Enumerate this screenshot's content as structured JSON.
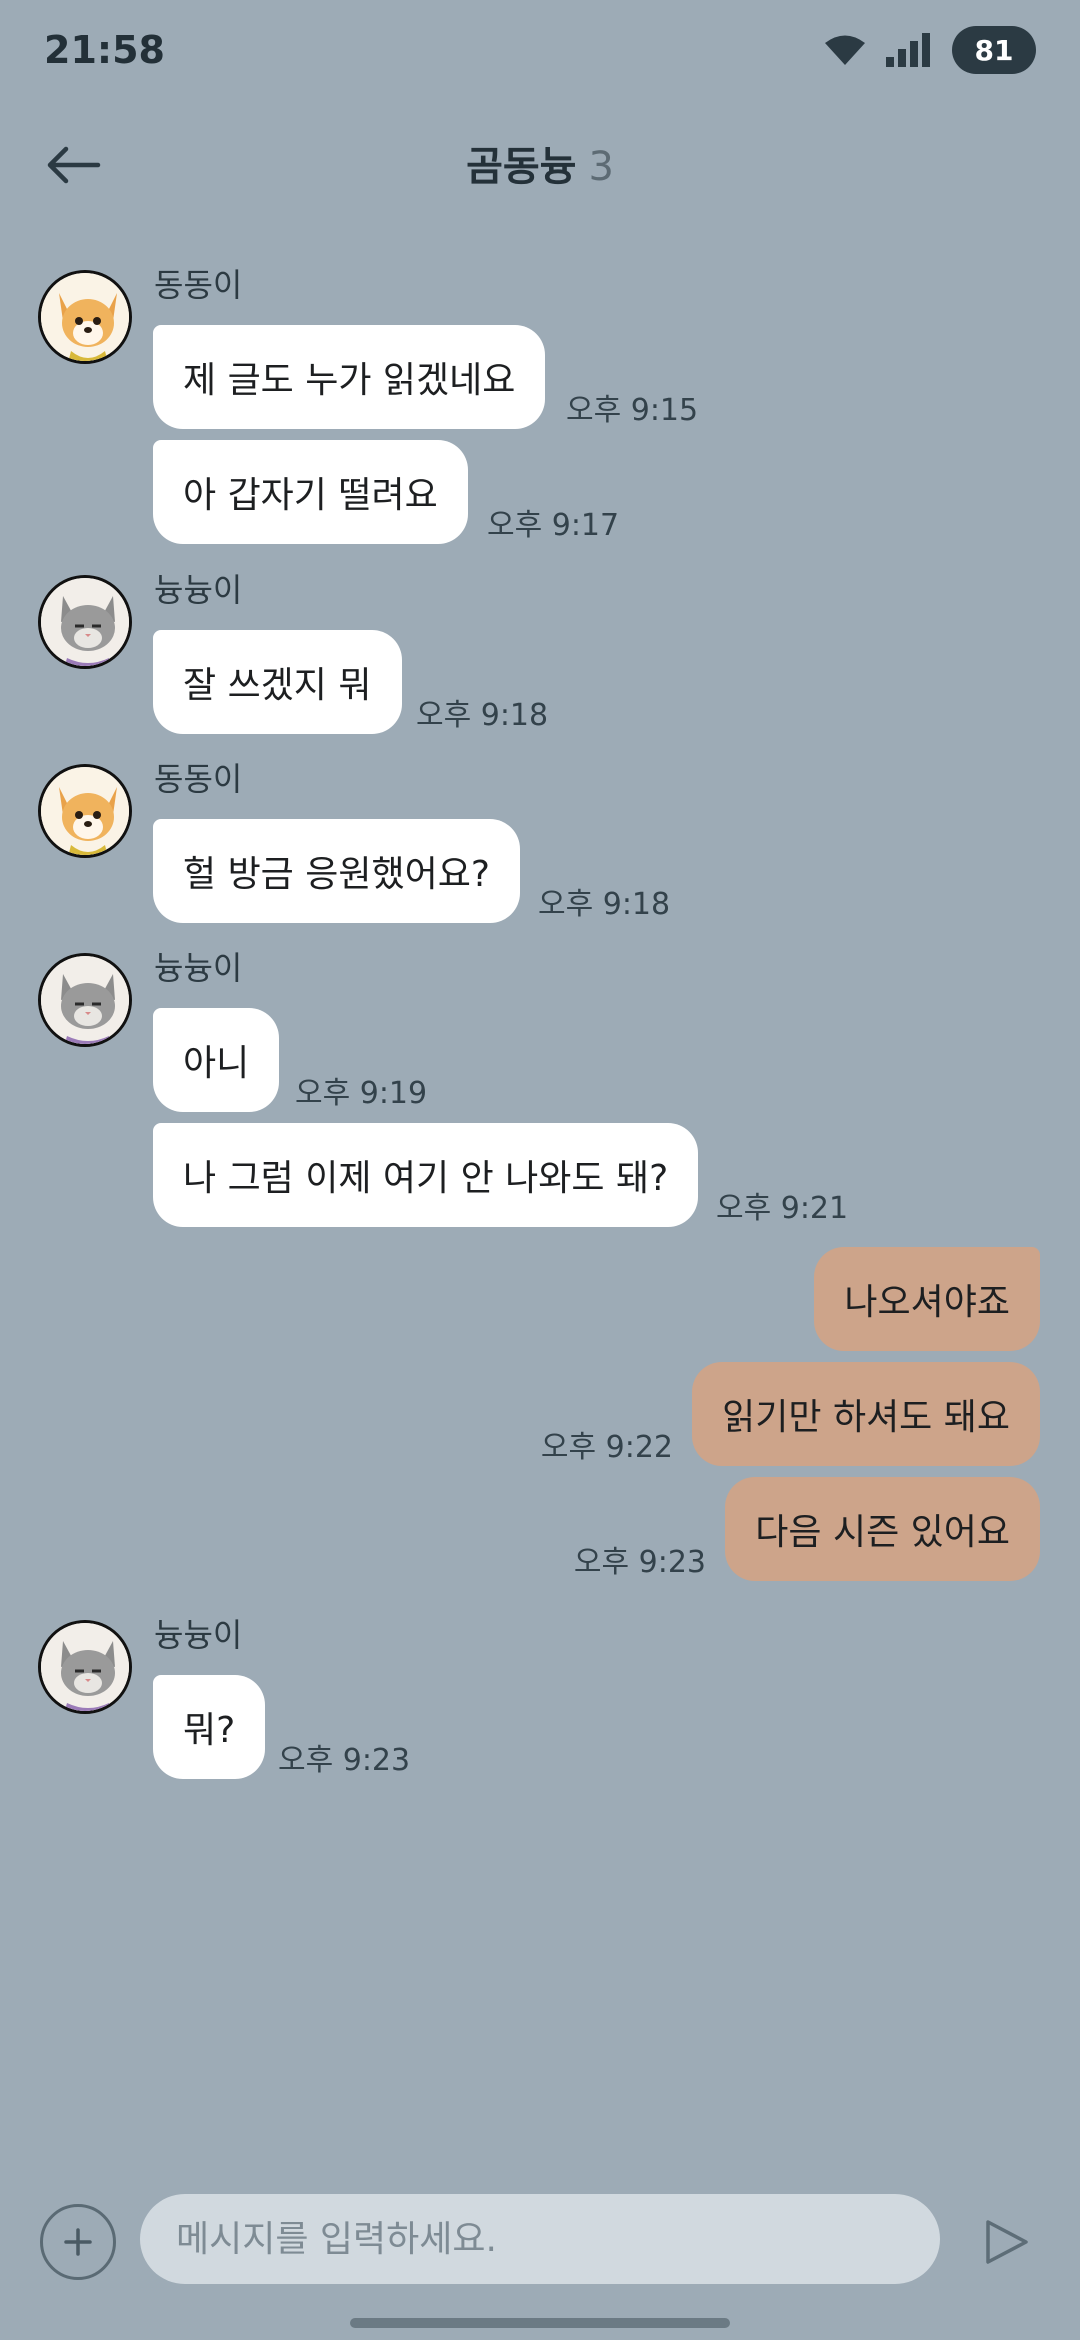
{
  "status_bar": {
    "time": "21:58",
    "battery": "81"
  },
  "header": {
    "title": "곰동늉",
    "count": "3"
  },
  "messages": [
    {
      "sender": "동동이",
      "avatar": "dog-avatar",
      "bubbles": [
        {
          "text": "제 글도 누가 읽겠네요",
          "time": "오후 9:15"
        },
        {
          "text": "아 갑자기 떨려요",
          "time": "오후 9:17"
        }
      ]
    },
    {
      "sender": "늉늉이",
      "avatar": "cat-avatar",
      "bubbles": [
        {
          "text": "잘 쓰겠지 뭐",
          "time": "오후 9:18"
        }
      ]
    },
    {
      "sender": "동동이",
      "avatar": "dog-avatar",
      "bubbles": [
        {
          "text": "헐 방금 응원했어요?",
          "time": "오후 9:18"
        }
      ]
    },
    {
      "sender": "늉늉이",
      "avatar": "cat-avatar",
      "bubbles": [
        {
          "text": "아니",
          "time": "오후 9:19"
        },
        {
          "text": "나 그럼 이제 여기 안 나와도 돼?",
          "time": "오후 9:21"
        }
      ]
    },
    {
      "sender": "me",
      "bubbles": [
        {
          "text": "나오셔야죠",
          "time": ""
        },
        {
          "text": "읽기만 하셔도 돼요",
          "time": "오후 9:22"
        },
        {
          "text": "다음 시즌 있어요",
          "time": "오후 9:23"
        }
      ]
    },
    {
      "sender": "늉늉이",
      "avatar": "cat-avatar",
      "bubbles": [
        {
          "text": "뭐?",
          "time": "오후 9:23"
        }
      ]
    }
  ],
  "input": {
    "placeholder": "메시지를 입력하세요."
  },
  "colors": {
    "background": "#9dabb6",
    "incoming_bubble": "#ffffff",
    "outgoing_bubble": "#cda48a"
  }
}
